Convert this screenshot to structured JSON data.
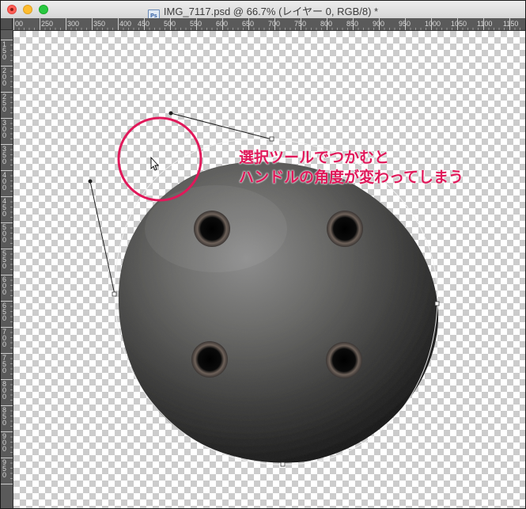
{
  "window": {
    "title": "IMG_7117.psd @ 66.7% (レイヤー 0, RGB/8) *",
    "doc_icon": "psd-file-icon"
  },
  "ruler": {
    "top_labels": [
      "00",
      "250",
      "300",
      "350",
      "400",
      "450",
      "500",
      "550",
      "600",
      "650",
      "700",
      "750",
      "800",
      "850",
      "900",
      "950",
      "1000",
      "1050",
      "1100",
      "1150"
    ],
    "left_labels": [
      "150",
      "200",
      "250",
      "300",
      "350",
      "400",
      "450",
      "500",
      "550",
      "600",
      "650",
      "700",
      "750",
      "800",
      "850",
      "900",
      "950"
    ]
  },
  "canvas": {
    "checker": "transparency-grid",
    "object": "iron-ball-with-four-holes",
    "tool_cursor": "selection-arrow-cursor"
  },
  "annotation": {
    "line1": "選択ツールでつかむと",
    "line2": "ハンドルの角度が変わってしまう",
    "color": "#e0195a"
  }
}
